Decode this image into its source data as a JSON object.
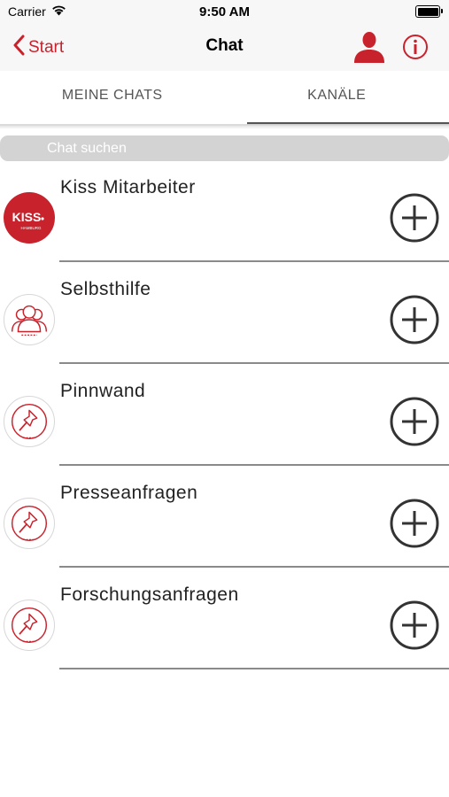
{
  "status_bar": {
    "carrier": "Carrier",
    "time": "9:50 AM"
  },
  "nav": {
    "back_label": "Start",
    "title": "Chat"
  },
  "tabs": [
    {
      "label": "MEINE CHATS",
      "active": false
    },
    {
      "label": "KANÄLE",
      "active": true
    }
  ],
  "search": {
    "placeholder": "Chat suchen"
  },
  "channels": [
    {
      "name": "Kiss Mitarbeiter",
      "icon": "kiss-logo-icon"
    },
    {
      "name": "Selbsthilfe",
      "icon": "group-icon"
    },
    {
      "name": "Pinnwand",
      "icon": "pushpin-icon"
    },
    {
      "name": "Presseanfragen",
      "icon": "pushpin-icon"
    },
    {
      "name": "Forschungsanfragen",
      "icon": "pushpin-icon"
    }
  ],
  "logo_text": {
    "kiss": "KISS",
    "hamburg": "HAMBURG"
  },
  "colors": {
    "accent": "#c8222c",
    "search_bg": "#d3d3d3",
    "divider": "#8a8a8a"
  }
}
